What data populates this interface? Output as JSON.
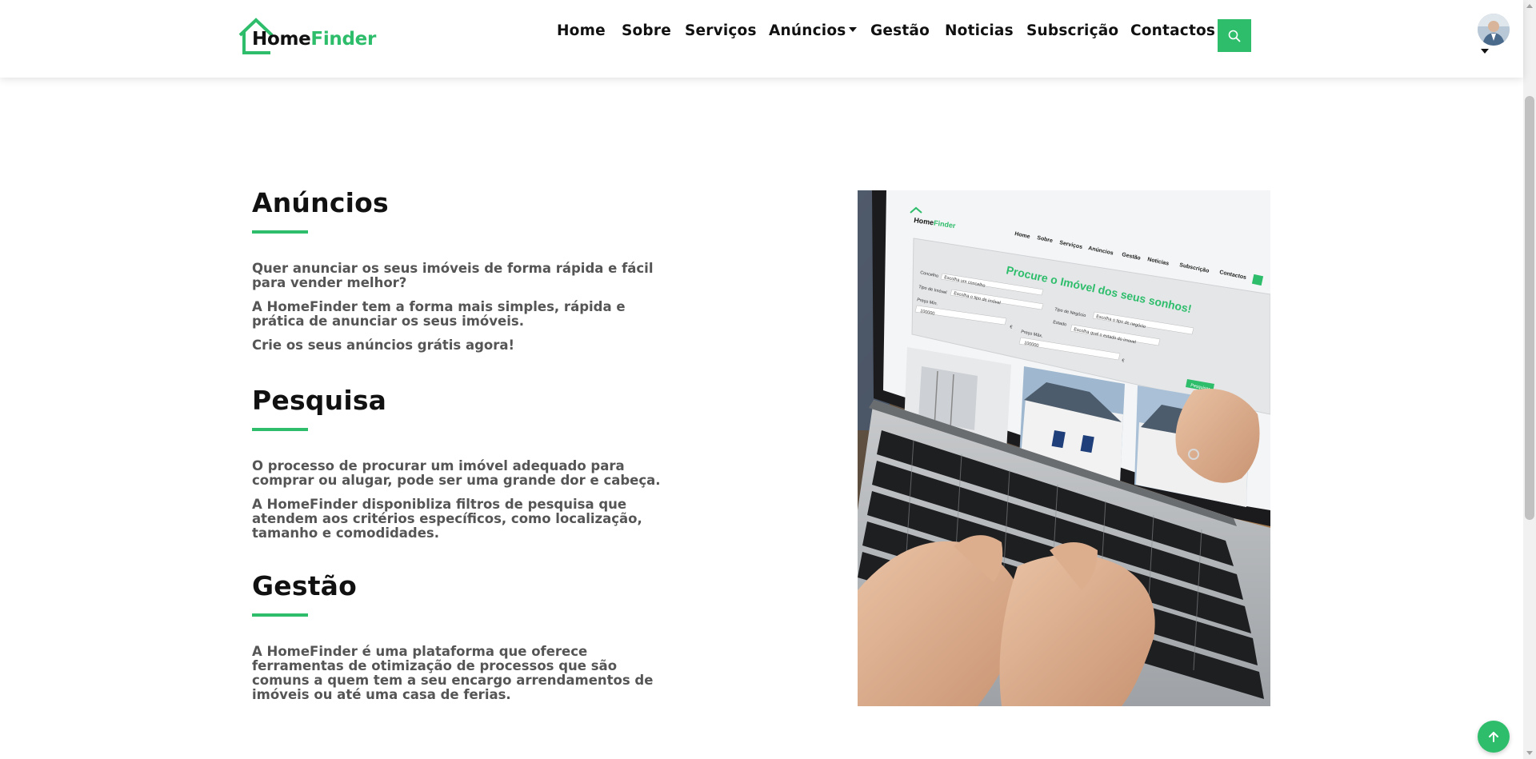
{
  "header": {
    "logo": {
      "home": "Home",
      "finder": "Finder"
    },
    "nav": [
      {
        "label": "Home",
        "key": "home"
      },
      {
        "label": "Sobre",
        "key": "sobre"
      },
      {
        "label": "Serviços",
        "key": "servicos"
      },
      {
        "label": "Anúncios",
        "key": "anuncios",
        "dropdown": true
      },
      {
        "label": "Gestão",
        "key": "gestao"
      },
      {
        "label": "Noticias",
        "key": "noticias"
      },
      {
        "label": "Subscrição",
        "key": "subscricao"
      },
      {
        "label": "Contactos",
        "key": "contactos"
      }
    ],
    "search_icon": "search-icon",
    "avatar_icon": "user-avatar"
  },
  "sections": [
    {
      "title": "Anúncios",
      "paragraphs": [
        "Quer anunciar os seus imóveis de forma rápida e fácil para vender melhor?",
        "A HomeFinder tem a forma mais simples, rápida e prática de anunciar os seus imóveis.",
        "Crie os seus anúncios grátis agora!"
      ]
    },
    {
      "title": "Pesquisa",
      "paragraphs": [
        "O processo de procurar um imóvel adequado para comprar ou alugar, pode ser uma grande dor e cabeça.",
        "A HomeFinder disponibliza filtros de pesquisa que atendem aos critérios específicos, como localização, tamanho e comodidades."
      ]
    },
    {
      "title": "Gestão",
      "paragraphs": [
        "A HomeFinder é uma plataforma que oferece ferramentas de otimização de processos que são comuns a quem tem a seu encargo arrendamentos de imóveis ou até uma casa de ferias."
      ]
    }
  ],
  "image": {
    "alt": "laptop-homefinder-screenshot",
    "screen_logo_home": "Home",
    "screen_logo_finder": "Finder",
    "screen_nav": [
      "Home",
      "Sobre",
      "Serviços",
      "Anúncios",
      "Gestão",
      "Noticias",
      "Subscrição",
      "Contactos"
    ],
    "screen_headline": "Procure o Imóvel dos seus sonhos!",
    "screen_fields": {
      "concelho": "Concelho",
      "concelho_placeholder": "Escolha um concelho",
      "tipo_imovel": "Tipo de Imóvel",
      "tipo_imovel_placeholder": "Escolha o tipo de imóvel",
      "tipo_negocio": "Tipo de Negócio",
      "tipo_negocio_placeholder": "Escolha o tipo de negócio",
      "estado": "Estado",
      "estado_placeholder": "Escolha qual o estado do imovel",
      "preco_min": "Preço Min.",
      "preco_min_value": "100000",
      "preco_max": "Preço Máx.",
      "preco_max_value": "100000",
      "currency": "€",
      "pesquisar": "Pesquisar"
    }
  },
  "colors": {
    "accent": "#2ebd6b",
    "text_dark": "#111111",
    "text_body": "#555555"
  },
  "back_to_top_icon": "arrow-up-icon"
}
